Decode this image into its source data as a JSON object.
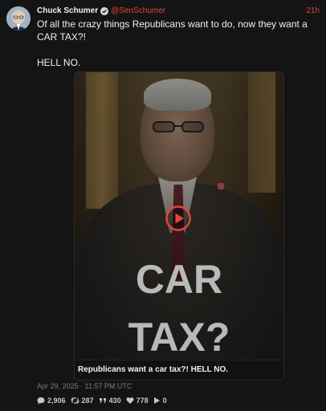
{
  "author": {
    "display_name": "Chuck Schumer",
    "handle": "@SenSchumer",
    "time_ago": "21h",
    "verified": true,
    "avatar_icon": "avatar-photo"
  },
  "tweet": {
    "text_line_1": "Of all the crazy things Republicans want to do, now they want a CAR TAX?!",
    "text_line_2": "HELL NO."
  },
  "media": {
    "type": "video",
    "overlay_line_1": "CAR",
    "overlay_line_2": "TAX?",
    "caption": "Republicans want a car tax?! HELL NO.",
    "play_icon": "play-icon"
  },
  "meta": {
    "timestamp": "Apr 29, 2025 · 11:57 PM UTC"
  },
  "stats": {
    "replies": "2,906",
    "retweets": "287",
    "quotes": "430",
    "likes": "778",
    "views": "0"
  },
  "colors": {
    "accent": "#e0463c",
    "background": "#141414",
    "text": "#f0f0f0",
    "muted": "#7a7a7a"
  }
}
